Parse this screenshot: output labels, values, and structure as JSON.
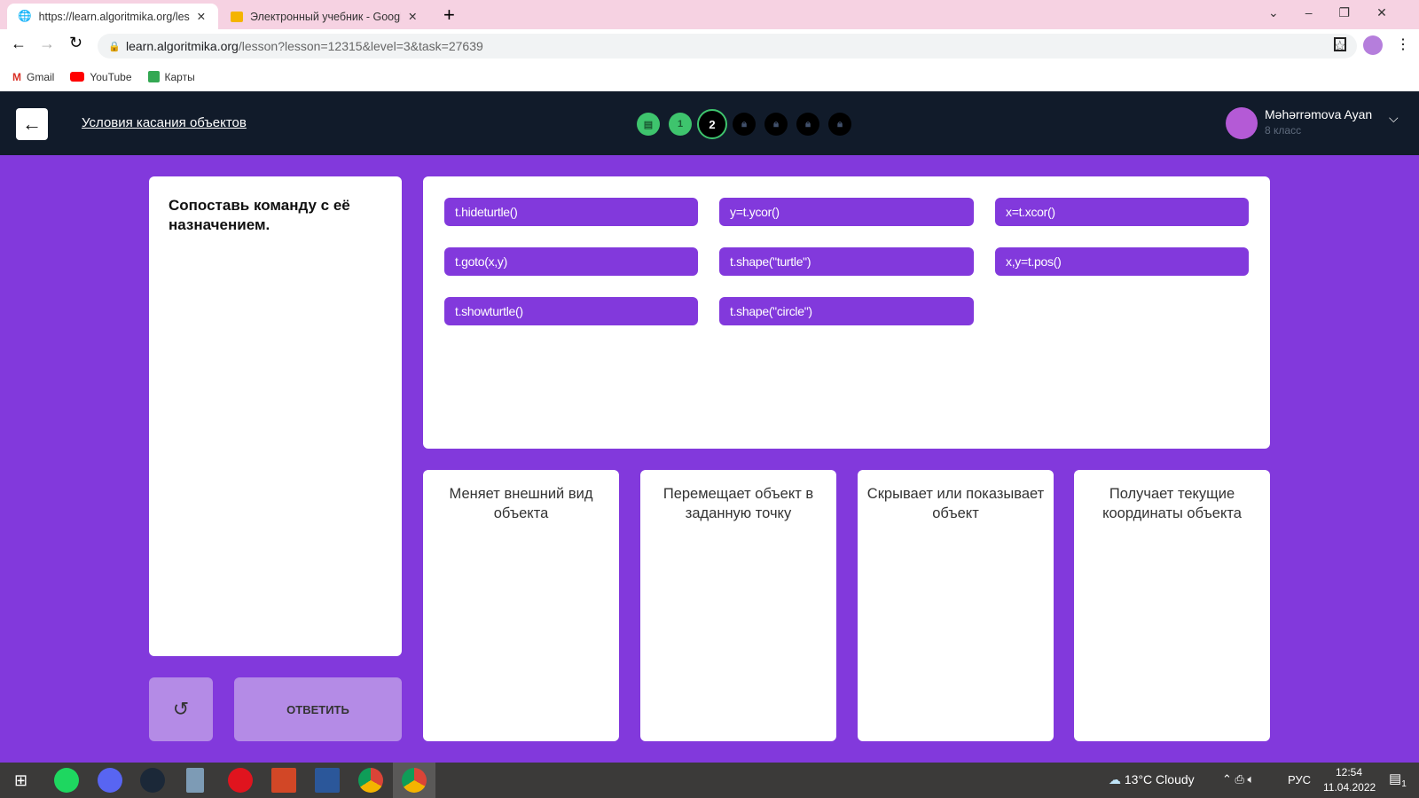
{
  "browser": {
    "tabs": [
      {
        "title": "https://learn.algoritmika.org/lesson"
      },
      {
        "title": "Электронный учебник - Google"
      }
    ],
    "url_host": "learn.algoritmika.org",
    "url_path": "/lesson?lesson=12315&level=3&task=27639",
    "bookmarks": [
      "Gmail",
      "YouTube",
      "Карты"
    ]
  },
  "header": {
    "lesson_title": "Условия касания объектов",
    "steps": [
      {
        "label": "",
        "state": "done-theory"
      },
      {
        "label": "1",
        "state": "done"
      },
      {
        "label": "2",
        "state": "current"
      },
      {
        "label": "",
        "state": "locked"
      },
      {
        "label": "",
        "state": "locked"
      },
      {
        "label": "",
        "state": "locked"
      },
      {
        "label": "",
        "state": "locked"
      }
    ],
    "user_name": "Məhərrəmova Ayan",
    "user_class": "8 класс"
  },
  "task": {
    "prompt": "Сопоставь команду с её назначением.",
    "answer_label": "ОТВЕТИТЬ"
  },
  "commands": [
    "t.hideturtle()",
    "y=t.ycor()",
    "x=t.xcor()",
    "t.goto(x,y)",
    "t.shape(\"turtle\")",
    "x,y=t.pos()",
    "t.showturtle()",
    "t.shape(\"circle\")"
  ],
  "categories": [
    "Меняет внешний вид объекта",
    "Перемещает объект в заданную точку",
    "Скрывает или показывает объект",
    "Получает текущие координаты объекта"
  ],
  "taskbar": {
    "weather": "13°C  Cloudy",
    "lang": "РУС",
    "time": "12:54",
    "date": "11.04.2022",
    "notifications": "1"
  },
  "colors": {
    "accent": "#8239dc",
    "header": "#111b2a",
    "success": "#3ec46d"
  }
}
